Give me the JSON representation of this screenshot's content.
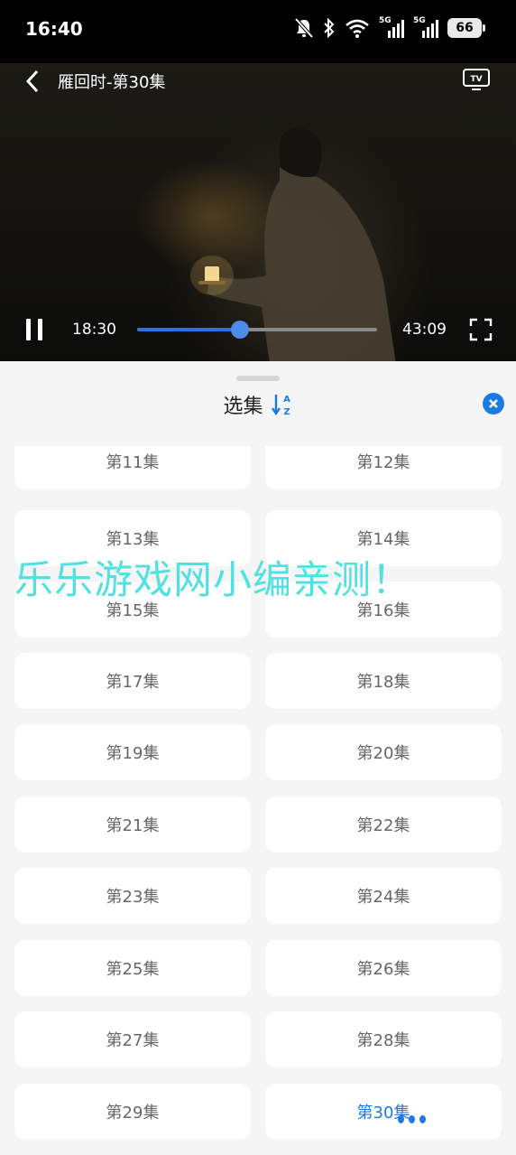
{
  "status_bar": {
    "time": "16:40",
    "battery": "66",
    "icons": [
      "mute-icon",
      "bluetooth-icon",
      "wifi-icon",
      "signal-5g-icon",
      "signal-5g-icon",
      "battery-icon"
    ],
    "net_label_1": "5G",
    "net_label_2": "5G"
  },
  "player": {
    "title": "雁回时-第30集",
    "tv_label": "TV",
    "current_time": "18:30",
    "total_time": "43:09",
    "progress": 0.4287
  },
  "episode_panel": {
    "title": "选集",
    "sort_label_top": "A",
    "sort_label_bottom": "Z",
    "episodes": [
      {
        "label": "第11集"
      },
      {
        "label": "第12集"
      },
      {
        "label": "第13集"
      },
      {
        "label": "第14集"
      },
      {
        "label": "第15集"
      },
      {
        "label": "第16集"
      },
      {
        "label": "第17集"
      },
      {
        "label": "第18集"
      },
      {
        "label": "第19集"
      },
      {
        "label": "第20集"
      },
      {
        "label": "第21集"
      },
      {
        "label": "第22集"
      },
      {
        "label": "第23集"
      },
      {
        "label": "第24集"
      },
      {
        "label": "第25集"
      },
      {
        "label": "第26集"
      },
      {
        "label": "第27集"
      },
      {
        "label": "第28集"
      },
      {
        "label": "第29集"
      },
      {
        "label": "第30集"
      }
    ],
    "current_episode": "第30集"
  },
  "watermark": "乐乐游戏网小编亲测！",
  "colors": {
    "accent": "#1c7be3",
    "progress": "#2f6fe0",
    "watermark": "#49e0e0"
  }
}
